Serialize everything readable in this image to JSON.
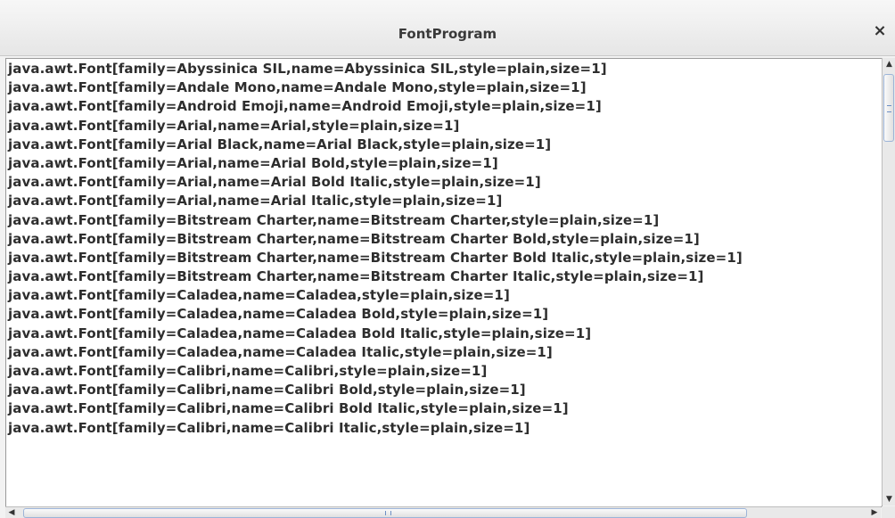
{
  "window": {
    "title": "FontProgram",
    "close_glyph": "×"
  },
  "list": {
    "items": [
      "java.awt.Font[family=Abyssinica SIL,name=Abyssinica SIL,style=plain,size=1]",
      "java.awt.Font[family=Andale Mono,name=Andale Mono,style=plain,size=1]",
      "java.awt.Font[family=Android Emoji,name=Android Emoji,style=plain,size=1]",
      "java.awt.Font[family=Arial,name=Arial,style=plain,size=1]",
      "java.awt.Font[family=Arial Black,name=Arial Black,style=plain,size=1]",
      "java.awt.Font[family=Arial,name=Arial Bold,style=plain,size=1]",
      "java.awt.Font[family=Arial,name=Arial Bold Italic,style=plain,size=1]",
      "java.awt.Font[family=Arial,name=Arial Italic,style=plain,size=1]",
      "java.awt.Font[family=Bitstream Charter,name=Bitstream Charter,style=plain,size=1]",
      "java.awt.Font[family=Bitstream Charter,name=Bitstream Charter Bold,style=plain,size=1]",
      "java.awt.Font[family=Bitstream Charter,name=Bitstream Charter Bold Italic,style=plain,size=1]",
      "java.awt.Font[family=Bitstream Charter,name=Bitstream Charter Italic,style=plain,size=1]",
      "java.awt.Font[family=Caladea,name=Caladea,style=plain,size=1]",
      "java.awt.Font[family=Caladea,name=Caladea Bold,style=plain,size=1]",
      "java.awt.Font[family=Caladea,name=Caladea Bold Italic,style=plain,size=1]",
      "java.awt.Font[family=Caladea,name=Caladea Italic,style=plain,size=1]",
      "java.awt.Font[family=Calibri,name=Calibri,style=plain,size=1]",
      "java.awt.Font[family=Calibri,name=Calibri Bold,style=plain,size=1]",
      "java.awt.Font[family=Calibri,name=Calibri Bold Italic,style=plain,size=1]",
      "java.awt.Font[family=Calibri,name=Calibri Italic,style=plain,size=1]"
    ]
  },
  "scrollbars": {
    "vertical": {
      "up_icon": "up-arrow-icon",
      "down_icon": "down-arrow-icon",
      "position": 0.0
    },
    "horizontal": {
      "left_icon": "left-arrow-icon",
      "right_icon": "right-arrow-icon",
      "position": 0.0
    }
  },
  "colors": {
    "titlebar": "#e9e9e9",
    "accent": "#9cb4d8",
    "text": "#2e2e2e"
  }
}
